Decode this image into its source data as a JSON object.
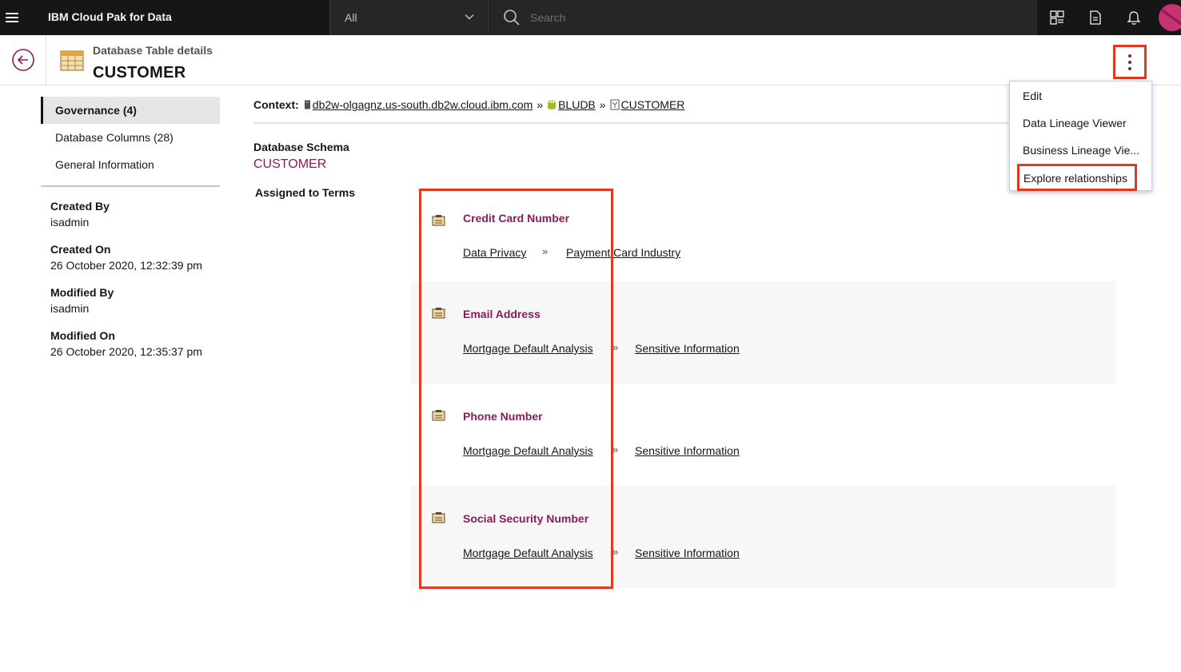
{
  "topbar": {
    "brand": "IBM Cloud Pak for Data",
    "scope_selected": "All",
    "search_placeholder": "Search",
    "icons": [
      "hamburger-menu-icon",
      "chevron-down-icon",
      "search-icon",
      "catalog-icon",
      "document-icon",
      "notification-bell-icon",
      "user-avatar"
    ]
  },
  "header": {
    "subtitle": "Database Table details",
    "title": "CUSTOMER"
  },
  "menu": {
    "items": [
      "Edit",
      "Data Lineage Viewer",
      "Business Lineage Vie...",
      "Explore relationships"
    ]
  },
  "nav": {
    "items": [
      "Governance (4)",
      "Database Columns (28)",
      "General Information"
    ],
    "active_index": 0
  },
  "meta": {
    "created_by_label": "Created By",
    "created_by": "isadmin",
    "created_on_label": "Created On",
    "created_on": "26 October 2020, 12:32:39 pm",
    "modified_by_label": "Modified By",
    "modified_by": "isadmin",
    "modified_on_label": "Modified On",
    "modified_on": "26 October 2020, 12:35:37 pm"
  },
  "context": {
    "label": "Context:",
    "host": "db2w-olgagnz.us-south.db2w.cloud.ibm.com",
    "database": "BLUDB",
    "table": "CUSTOMER",
    "separator": "»"
  },
  "schema": {
    "label": "Database Schema",
    "value": "CUSTOMER"
  },
  "terms": {
    "label": "Assigned to Terms",
    "items": [
      {
        "name": "Credit Card Number",
        "path": [
          "Data Privacy",
          "Payment Card Industry"
        ],
        "separator": "»"
      },
      {
        "name": "Email Address",
        "path": [
          "Mortgage Default Analysis",
          "Sensitive Information"
        ],
        "separator": "»"
      },
      {
        "name": "Phone Number",
        "path": [
          "Mortgage Default Analysis",
          "Sensitive Information"
        ],
        "separator": "»"
      },
      {
        "name": "Social Security Number",
        "path": [
          "Mortgage Default Analysis",
          "Sensitive Information"
        ],
        "separator": "»"
      }
    ]
  },
  "colors": {
    "accent": "#8a1d55",
    "highlight_box": "#e2391f",
    "topbar_bg": "#161616"
  }
}
